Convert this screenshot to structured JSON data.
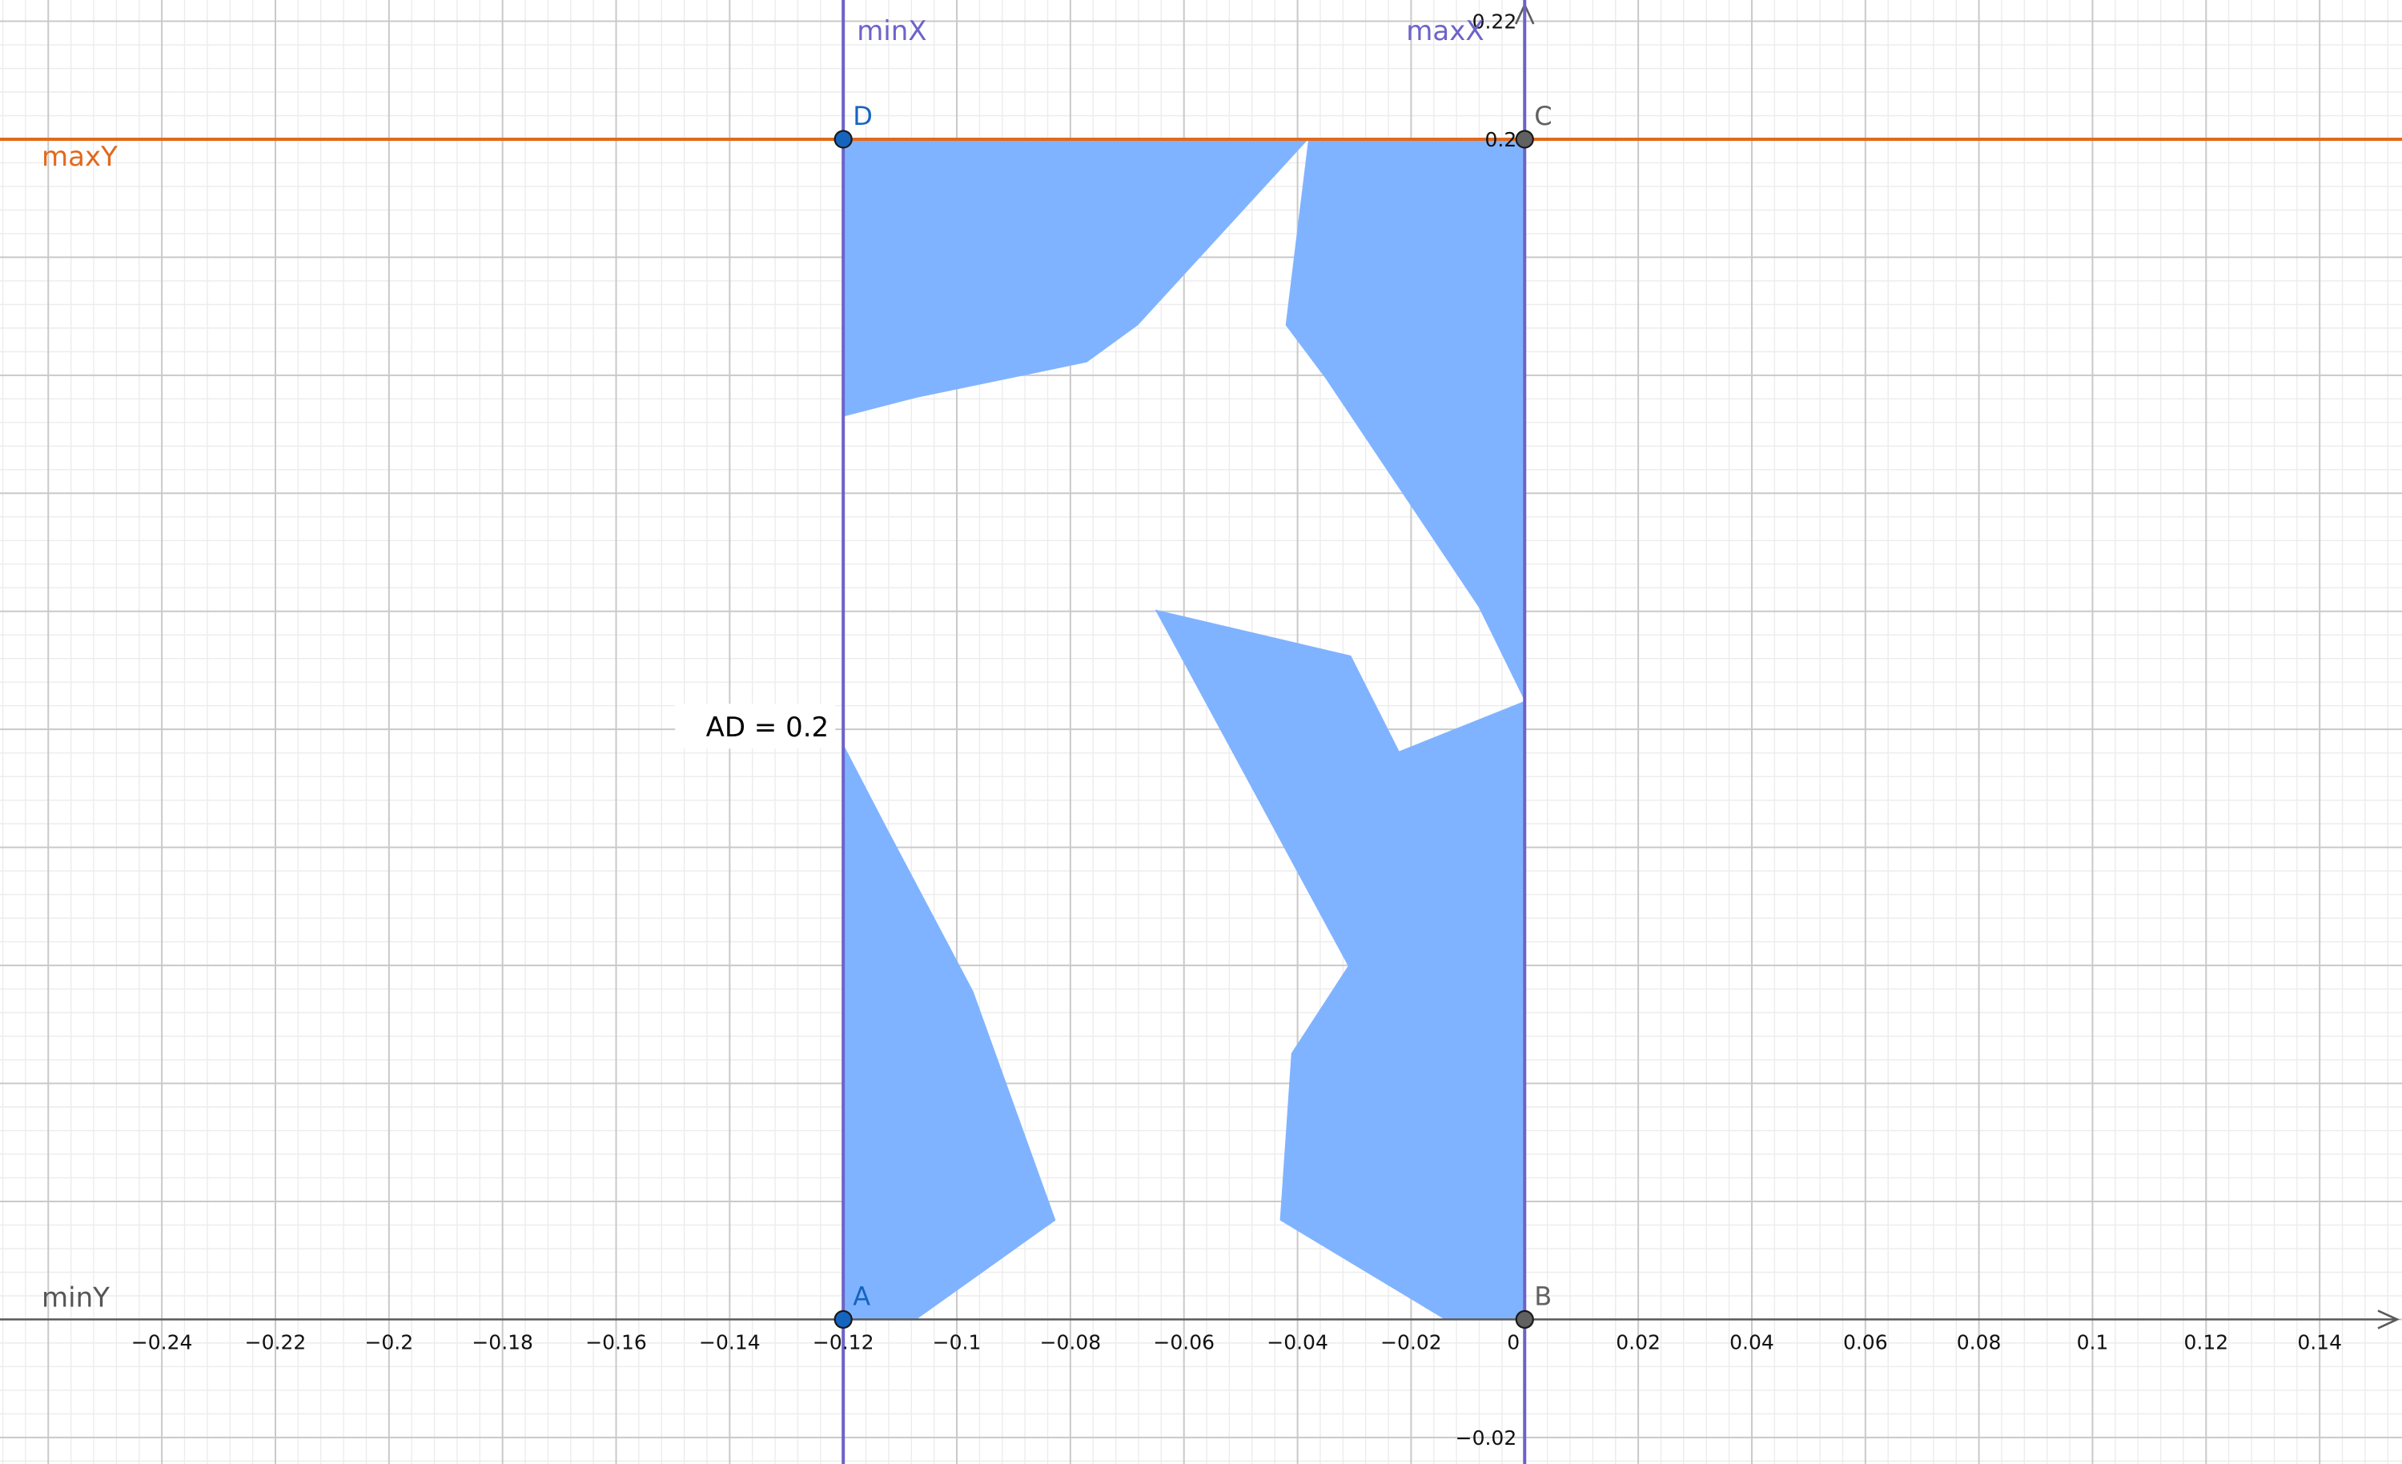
{
  "view": {
    "x_range": [
      -0.2685,
      0.1545
    ],
    "y_range": [
      -0.0245,
      0.2236
    ],
    "minor_grid_step": 0.004,
    "major_grid_step": 0.02
  },
  "colors": {
    "background": "#ffffff",
    "grid_minor": "#ececec",
    "grid_major": "#c9c9c9",
    "axis": "#5a5a5a",
    "fill": "#80b3ff",
    "vertical_lines": "#6c63c9",
    "max_y_line": "#e06a1e",
    "point_blue": "#1565c0",
    "point_gray": "#616161",
    "text_gray": "#555555"
  },
  "axes": {
    "x_ticks": [
      {
        "value": -0.24,
        "label": "−0.24"
      },
      {
        "value": -0.22,
        "label": "−0.22"
      },
      {
        "value": -0.2,
        "label": "−0.2"
      },
      {
        "value": -0.18,
        "label": "−0.18"
      },
      {
        "value": -0.16,
        "label": "−0.16"
      },
      {
        "value": -0.14,
        "label": "−0.14"
      },
      {
        "value": -0.12,
        "label": "−0.12"
      },
      {
        "value": -0.1,
        "label": "−0.1"
      },
      {
        "value": -0.08,
        "label": "−0.08"
      },
      {
        "value": -0.06,
        "label": "−0.06"
      },
      {
        "value": -0.04,
        "label": "−0.04"
      },
      {
        "value": -0.02,
        "label": "−0.02"
      },
      {
        "value": 0,
        "label": "0"
      },
      {
        "value": 0.02,
        "label": "0.02"
      },
      {
        "value": 0.04,
        "label": "0.04"
      },
      {
        "value": 0.06,
        "label": "0.06"
      },
      {
        "value": 0.08,
        "label": "0.08"
      },
      {
        "value": 0.1,
        "label": "0.1"
      },
      {
        "value": 0.12,
        "label": "0.12"
      },
      {
        "value": 0.14,
        "label": "0.14"
      }
    ],
    "y_ticks": [
      {
        "value": 0.22,
        "label": "0.22"
      },
      {
        "value": 0.2,
        "label": "0.2"
      },
      {
        "value": -0.02,
        "label": "−0.02"
      }
    ]
  },
  "lines": [
    {
      "name": "minX",
      "orientation": "vertical",
      "value": -0.12,
      "color": "#6c63c9"
    },
    {
      "name": "maxX",
      "orientation": "vertical",
      "value": 0,
      "color": "#6c63c9"
    },
    {
      "name": "maxY",
      "orientation": "horizontal",
      "value": 0.2,
      "color": "#e06a1e"
    },
    {
      "name": "minY",
      "orientation": "horizontal",
      "value": 0,
      "color": "#5a5a5a"
    }
  ],
  "points": [
    {
      "name": "A",
      "x": -0.12,
      "y": 0,
      "style": "blue"
    },
    {
      "name": "B",
      "x": 0,
      "y": 0,
      "style": "gray"
    },
    {
      "name": "C",
      "x": 0,
      "y": 0.2,
      "style": "gray"
    },
    {
      "name": "D",
      "x": -0.12,
      "y": 0.2,
      "style": "blue"
    }
  ],
  "measurement": {
    "text": "AD = 0.2",
    "x": -0.12,
    "y": 0.1
  },
  "rectangle": {
    "x_min": -0.12,
    "x_max": 0,
    "y_min": 0,
    "y_max": 0.2
  },
  "knight_shape": [
    [
      -0.12,
      0.153
    ],
    [
      -0.1071,
      0.1562
    ],
    [
      -0.0771,
      0.1622
    ],
    [
      -0.0681,
      0.1685
    ],
    [
      -0.0381,
      0.2
    ],
    [
      -0.0421,
      0.1685
    ],
    [
      -0.0351,
      0.1595
    ],
    [
      -0.0081,
      0.1207
    ],
    [
      0,
      0.1048
    ],
    [
      -0.0221,
      0.0963
    ],
    [
      -0.0306,
      0.1125
    ],
    [
      -0.0651,
      0.1203
    ],
    [
      -0.0311,
      0.0599
    ],
    [
      -0.0411,
      0.0451
    ],
    [
      -0.0431,
      0.0168
    ],
    [
      -0.0141,
      0
    ],
    [
      -0.1071,
      0
    ],
    [
      -0.0826,
      0.0168
    ],
    [
      -0.0971,
      0.0556
    ],
    [
      -0.1126,
      0.0838
    ],
    [
      -0.12,
      0.0975
    ]
  ]
}
